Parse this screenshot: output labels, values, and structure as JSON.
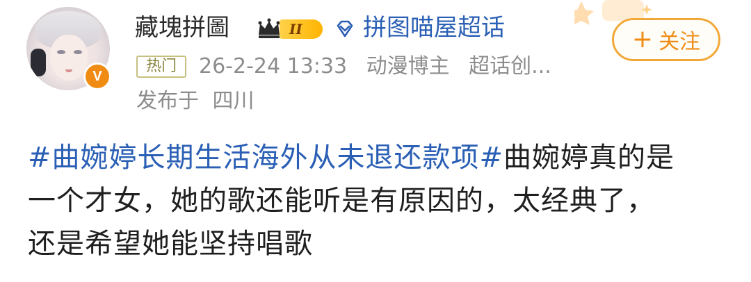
{
  "author": {
    "name": "藏塊拼圖",
    "level_badge": "II",
    "verified_badge": "V"
  },
  "topic": {
    "name": "拼图喵屋超话"
  },
  "follow_button": {
    "plus": "+",
    "label": "关注"
  },
  "meta": {
    "hot_tag": "热门",
    "timestamp": "26-2-24 13:33",
    "role": "动漫博主",
    "extra": "超话创..."
  },
  "location": {
    "label": "发布于",
    "place": "四川"
  },
  "post": {
    "hashtag": "#曲婉婷长期生活海外从未退还款项#",
    "line1_rest": "曲婉婷真的是",
    "line2": "一个才女，她的歌还能听是有原因的，太经典了，",
    "line3": "还是希望她能坚持唱歌"
  },
  "colors": {
    "link_blue": "#2a5fb5",
    "follow_orange": "#f08c14",
    "meta_gray": "#8c8c8c"
  }
}
